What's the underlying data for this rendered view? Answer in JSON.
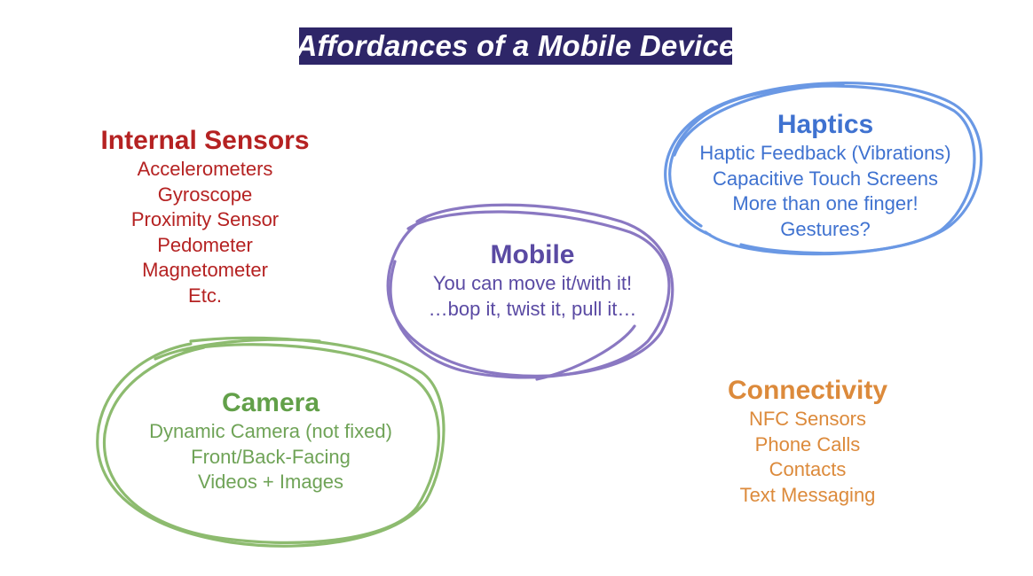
{
  "title": "Affordances of a Mobile Device",
  "colors": {
    "title_background": "#2e2668",
    "title_text": "#ffffff",
    "internal_sensors": "#b52222",
    "haptics": "#3f72d0",
    "haptics_circle": "#6a98e4",
    "mobile": "#5a4aa3",
    "mobile_circle": "#8a78c2",
    "camera": "#6fa357",
    "camera_circle": "#8dbb6f",
    "connectivity": "#dc8a3b"
  },
  "groups": {
    "internal_sensors": {
      "heading": "Internal Sensors",
      "items": [
        "Accelerometers",
        "Gyroscope",
        "Proximity Sensor",
        "Pedometer",
        "Magnetometer",
        "Etc."
      ],
      "circled": false
    },
    "haptics": {
      "heading": "Haptics",
      "items": [
        "Haptic Feedback (Vibrations)",
        "Capacitive Touch Screens",
        "More than one finger!",
        "Gestures?"
      ],
      "circled": true
    },
    "mobile": {
      "heading": "Mobile",
      "items": [
        "You can move it/with it!",
        "…bop it, twist it, pull it…"
      ],
      "circled": true
    },
    "camera": {
      "heading": "Camera",
      "items": [
        "Dynamic Camera (not fixed)",
        "Front/Back-Facing",
        "Videos + Images"
      ],
      "circled": true
    },
    "connectivity": {
      "heading": "Connectivity",
      "items": [
        "NFC Sensors",
        "Phone Calls",
        "Contacts",
        "Text Messaging"
      ],
      "circled": false
    }
  }
}
